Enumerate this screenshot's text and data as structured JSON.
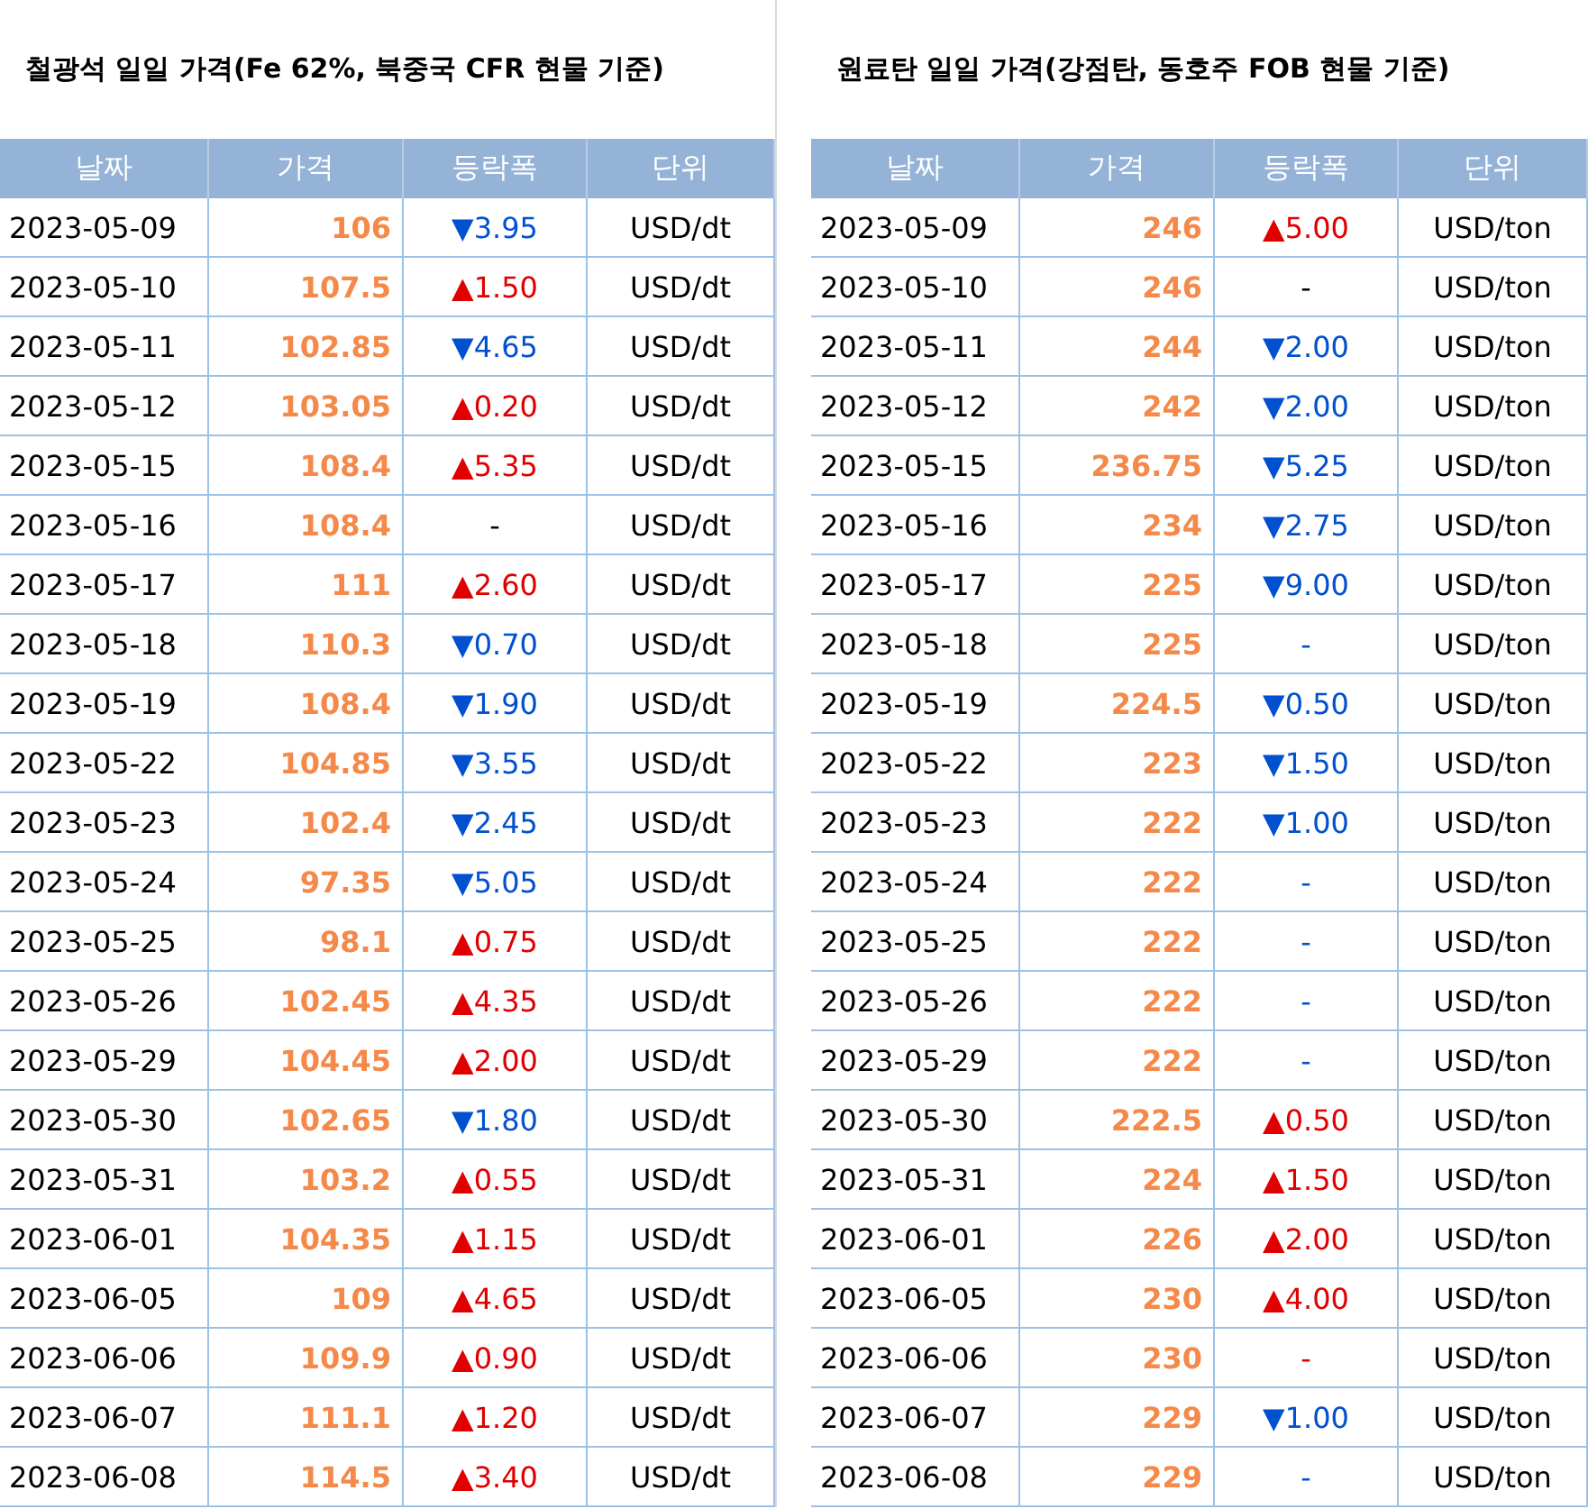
{
  "tables": [
    {
      "title": "철광석 일일 가격(Fe 62%, 북중국 CFR 현물 기준)",
      "columns": [
        "날짜",
        "가격",
        "등락폭",
        "단위"
      ],
      "rows": [
        {
          "date": "2023-05-09",
          "price": "106",
          "change": "▼3.95",
          "kind": "down",
          "unit": "USD/dt"
        },
        {
          "date": "2023-05-10",
          "price": "107.5",
          "change": "▲1.50",
          "kind": "up",
          "unit": "USD/dt"
        },
        {
          "date": "2023-05-11",
          "price": "102.85",
          "change": "▼4.65",
          "kind": "down",
          "unit": "USD/dt"
        },
        {
          "date": "2023-05-12",
          "price": "103.05",
          "change": "▲0.20",
          "kind": "up",
          "unit": "USD/dt"
        },
        {
          "date": "2023-05-15",
          "price": "108.4",
          "change": "▲5.35",
          "kind": "up",
          "unit": "USD/dt"
        },
        {
          "date": "2023-05-16",
          "price": "108.4",
          "change": "-",
          "kind": "none",
          "unit": "USD/dt"
        },
        {
          "date": "2023-05-17",
          "price": "111",
          "change": "▲2.60",
          "kind": "up",
          "unit": "USD/dt"
        },
        {
          "date": "2023-05-18",
          "price": "110.3",
          "change": "▼0.70",
          "kind": "down",
          "unit": "USD/dt"
        },
        {
          "date": "2023-05-19",
          "price": "108.4",
          "change": "▼1.90",
          "kind": "down",
          "unit": "USD/dt"
        },
        {
          "date": "2023-05-22",
          "price": "104.85",
          "change": "▼3.55",
          "kind": "down",
          "unit": "USD/dt"
        },
        {
          "date": "2023-05-23",
          "price": "102.4",
          "change": "▼2.45",
          "kind": "down",
          "unit": "USD/dt"
        },
        {
          "date": "2023-05-24",
          "price": "97.35",
          "change": "▼5.05",
          "kind": "down",
          "unit": "USD/dt"
        },
        {
          "date": "2023-05-25",
          "price": "98.1",
          "change": "▲0.75",
          "kind": "up",
          "unit": "USD/dt"
        },
        {
          "date": "2023-05-26",
          "price": "102.45",
          "change": "▲4.35",
          "kind": "up",
          "unit": "USD/dt"
        },
        {
          "date": "2023-05-29",
          "price": "104.45",
          "change": "▲2.00",
          "kind": "up",
          "unit": "USD/dt"
        },
        {
          "date": "2023-05-30",
          "price": "102.65",
          "change": "▼1.80",
          "kind": "down",
          "unit": "USD/dt"
        },
        {
          "date": "2023-05-31",
          "price": "103.2",
          "change": "▲0.55",
          "kind": "up",
          "unit": "USD/dt"
        },
        {
          "date": "2023-06-01",
          "price": "104.35",
          "change": "▲1.15",
          "kind": "up",
          "unit": "USD/dt"
        },
        {
          "date": "2023-06-05",
          "price": "109",
          "change": "▲4.65",
          "kind": "up",
          "unit": "USD/dt"
        },
        {
          "date": "2023-06-06",
          "price": "109.9",
          "change": "▲0.90",
          "kind": "up",
          "unit": "USD/dt"
        },
        {
          "date": "2023-06-07",
          "price": "111.1",
          "change": "▲1.20",
          "kind": "up",
          "unit": "USD/dt"
        },
        {
          "date": "2023-06-08",
          "price": "114.5",
          "change": "▲3.40",
          "kind": "up",
          "unit": "USD/dt"
        }
      ]
    },
    {
      "title": "원료탄 일일 가격(강점탄, 동호주 FOB 현물 기준)",
      "columns": [
        "날짜",
        "가격",
        "등락폭",
        "단위"
      ],
      "rows": [
        {
          "date": "2023-05-09",
          "price": "246",
          "change": "▲5.00",
          "kind": "up",
          "unit": "USD/ton"
        },
        {
          "date": "2023-05-10",
          "price": "246",
          "change": "-",
          "kind": "none",
          "unit": "USD/ton"
        },
        {
          "date": "2023-05-11",
          "price": "244",
          "change": "▼2.00",
          "kind": "down",
          "unit": "USD/ton"
        },
        {
          "date": "2023-05-12",
          "price": "242",
          "change": "▼2.00",
          "kind": "down",
          "unit": "USD/ton"
        },
        {
          "date": "2023-05-15",
          "price": "236.75",
          "change": "▼5.25",
          "kind": "down",
          "unit": "USD/ton"
        },
        {
          "date": "2023-05-16",
          "price": "234",
          "change": "▼2.75",
          "kind": "down",
          "unit": "USD/ton"
        },
        {
          "date": "2023-05-17",
          "price": "225",
          "change": "▼9.00",
          "kind": "down",
          "unit": "USD/ton"
        },
        {
          "date": "2023-05-18",
          "price": "225",
          "change": "-",
          "kind": "down",
          "unit": "USD/ton"
        },
        {
          "date": "2023-05-19",
          "price": "224.5",
          "change": "▼0.50",
          "kind": "down",
          "unit": "USD/ton"
        },
        {
          "date": "2023-05-22",
          "price": "223",
          "change": "▼1.50",
          "kind": "down",
          "unit": "USD/ton"
        },
        {
          "date": "2023-05-23",
          "price": "222",
          "change": "▼1.00",
          "kind": "down",
          "unit": "USD/ton"
        },
        {
          "date": "2023-05-24",
          "price": "222",
          "change": "-",
          "kind": "down",
          "unit": "USD/ton"
        },
        {
          "date": "2023-05-25",
          "price": "222",
          "change": "-",
          "kind": "down",
          "unit": "USD/ton"
        },
        {
          "date": "2023-05-26",
          "price": "222",
          "change": "-",
          "kind": "down",
          "unit": "USD/ton"
        },
        {
          "date": "2023-05-29",
          "price": "222",
          "change": "-",
          "kind": "down",
          "unit": "USD/ton"
        },
        {
          "date": "2023-05-30",
          "price": "222.5",
          "change": "▲0.50",
          "kind": "up",
          "unit": "USD/ton"
        },
        {
          "date": "2023-05-31",
          "price": "224",
          "change": "▲1.50",
          "kind": "up",
          "unit": "USD/ton"
        },
        {
          "date": "2023-06-01",
          "price": "226",
          "change": "▲2.00",
          "kind": "up",
          "unit": "USD/ton"
        },
        {
          "date": "2023-06-05",
          "price": "230",
          "change": "▲4.00",
          "kind": "up",
          "unit": "USD/ton"
        },
        {
          "date": "2023-06-06",
          "price": "230",
          "change": "-",
          "kind": "up",
          "unit": "USD/ton"
        },
        {
          "date": "2023-06-07",
          "price": "229",
          "change": "▼1.00",
          "kind": "down",
          "unit": "USD/ton"
        },
        {
          "date": "2023-06-08",
          "price": "229",
          "change": "-",
          "kind": "down",
          "unit": "USD/ton"
        }
      ]
    }
  ]
}
